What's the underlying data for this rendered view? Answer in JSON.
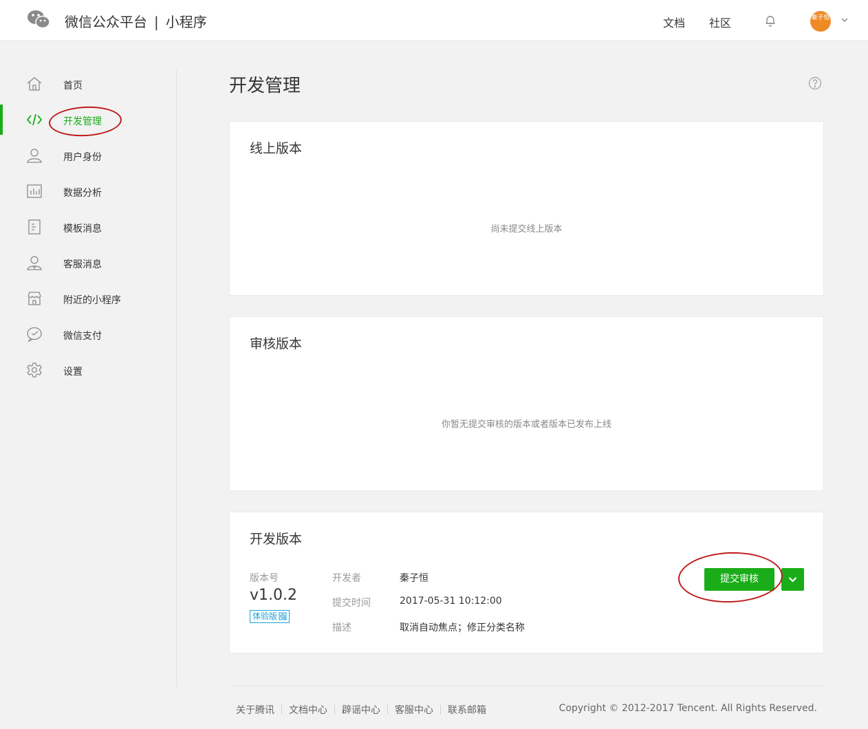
{
  "header": {
    "brand": "微信公众平台",
    "brand_sep": "|",
    "product": "小程序",
    "links": {
      "docs": "文档",
      "community": "社区"
    },
    "avatar_text": "秦子恒",
    "icons": {
      "logo": "wechat-logo",
      "bell": "bell-icon",
      "caret": "chevron-down-icon"
    }
  },
  "sidebar": {
    "items": [
      {
        "label": "首页",
        "icon": "home-icon"
      },
      {
        "label": "开发管理",
        "icon": "code-icon",
        "active": true
      },
      {
        "label": "用户身份",
        "icon": "user-icon"
      },
      {
        "label": "数据分析",
        "icon": "chart-icon"
      },
      {
        "label": "模板消息",
        "icon": "document-icon"
      },
      {
        "label": "客服消息",
        "icon": "customer-service-icon"
      },
      {
        "label": "附近的小程序",
        "icon": "store-icon"
      },
      {
        "label": "微信支付",
        "icon": "pay-icon"
      },
      {
        "label": "设置",
        "icon": "gear-icon"
      }
    ],
    "accent": "#1aad19"
  },
  "main": {
    "title": "开发管理",
    "online": {
      "title": "线上版本",
      "empty": "尚未提交线上版本"
    },
    "review": {
      "title": "审核版本",
      "empty": "你暂无提交审核的版本或者版本已发布上线"
    },
    "dev": {
      "title": "开发版本",
      "version_label": "版本号",
      "version": "v1.0.2",
      "badge": "体验版",
      "developer_label": "开发者",
      "developer": "秦子恒",
      "time_label": "提交时间",
      "time": "2017-05-31 10:12:00",
      "desc_label": "描述",
      "desc": "取消自动焦点；修正分类名称",
      "submit_label": "提交审核"
    }
  },
  "footer": {
    "links": [
      "关于腾讯",
      "文档中心",
      "辟谣中心",
      "客服中心",
      "联系邮箱"
    ],
    "copyright": "Copyright © 2012-2017 Tencent. All Rights Reserved."
  },
  "colors": {
    "primary": "#1aad19",
    "annotation": "#c01a1a",
    "badge": "#1aa1d9"
  }
}
